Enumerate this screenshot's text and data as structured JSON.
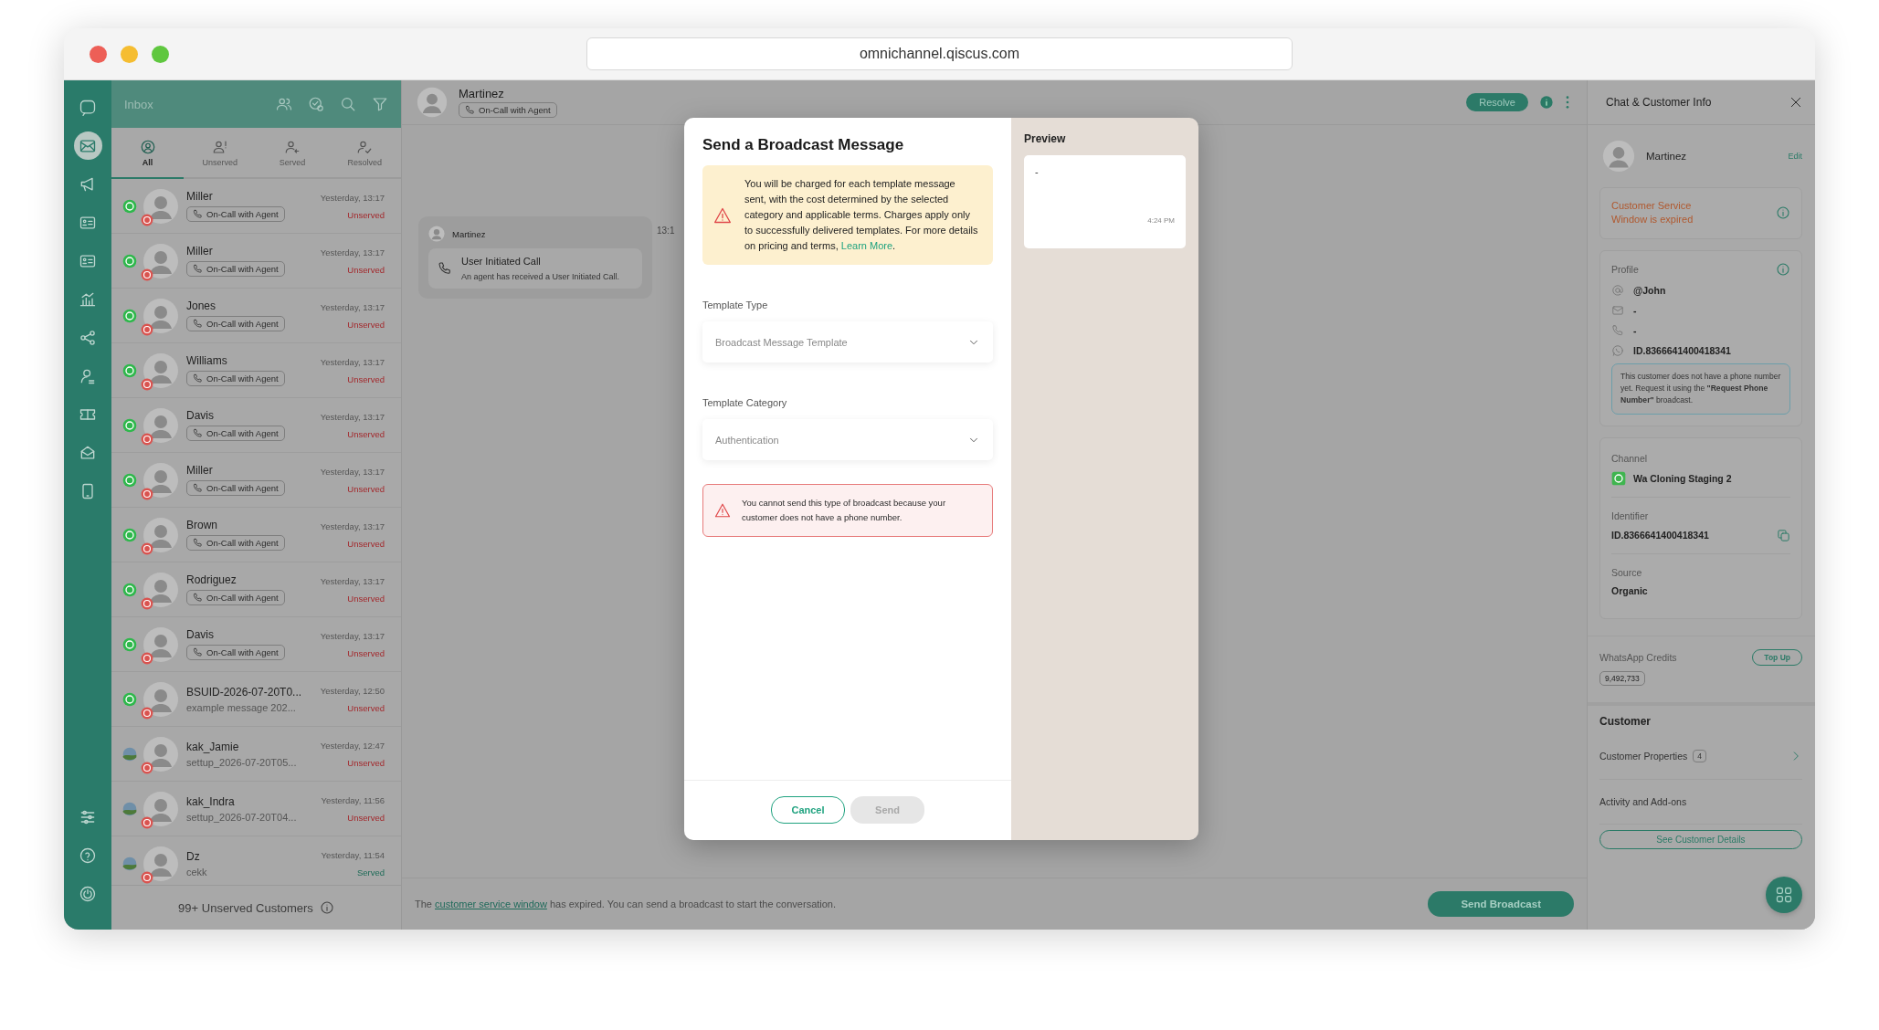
{
  "browser": {
    "url": "omnichannel.qiscus.com"
  },
  "nav": {
    "top": [
      {
        "kind": "chat",
        "selected": false
      },
      {
        "kind": "mail",
        "selected": true
      },
      {
        "kind": "megaphone",
        "selected": false
      },
      {
        "kind": "card",
        "selected": false
      },
      {
        "kind": "card",
        "selected": false
      },
      {
        "kind": "chart",
        "selected": false
      },
      {
        "kind": "share",
        "selected": false
      },
      {
        "kind": "person",
        "selected": false
      },
      {
        "kind": "ticket",
        "selected": false
      },
      {
        "kind": "tray",
        "selected": false
      },
      {
        "kind": "phone",
        "selected": false
      }
    ],
    "bottom": [
      {
        "kind": "sliders",
        "selected": false
      },
      {
        "kind": "help",
        "selected": false
      },
      {
        "kind": "power",
        "selected": false
      }
    ]
  },
  "inbox": {
    "title": "Inbox",
    "tabs": [
      {
        "label": "All",
        "kind": "all",
        "selected": true
      },
      {
        "label": "Unserved",
        "kind": "unserved",
        "selected": false
      },
      {
        "label": "Served",
        "kind": "served",
        "selected": false
      },
      {
        "label": "Resolved",
        "kind": "resolved",
        "selected": false
      }
    ],
    "conversations": [
      {
        "name": "Miller",
        "time": "Yesterday, 13:17",
        "kind": "call",
        "tag": "On-Call with Agent",
        "status": "Unserved",
        "served": false,
        "whatsapp": true
      },
      {
        "name": "Miller",
        "time": "Yesterday, 13:17",
        "kind": "call",
        "tag": "On-Call with Agent",
        "status": "Unserved",
        "served": false,
        "whatsapp": true
      },
      {
        "name": "Jones",
        "time": "Yesterday, 13:17",
        "kind": "call",
        "tag": "On-Call with Agent",
        "status": "Unserved",
        "served": false,
        "whatsapp": true
      },
      {
        "name": "Williams",
        "time": "Yesterday, 13:17",
        "kind": "call",
        "tag": "On-Call with Agent",
        "status": "Unserved",
        "served": false,
        "whatsapp": true
      },
      {
        "name": "Davis",
        "time": "Yesterday, 13:17",
        "kind": "call",
        "tag": "On-Call with Agent",
        "status": "Unserved",
        "served": false,
        "whatsapp": true
      },
      {
        "name": "Miller",
        "time": "Yesterday, 13:17",
        "kind": "call",
        "tag": "On-Call with Agent",
        "status": "Unserved",
        "served": false,
        "whatsapp": true
      },
      {
        "name": "Brown",
        "time": "Yesterday, 13:17",
        "kind": "call",
        "tag": "On-Call with Agent",
        "status": "Unserved",
        "served": false,
        "whatsapp": true
      },
      {
        "name": "Rodriguez",
        "time": "Yesterday, 13:17",
        "kind": "call",
        "tag": "On-Call with Agent",
        "status": "Unserved",
        "served": false,
        "whatsapp": true
      },
      {
        "name": "Davis",
        "time": "Yesterday, 13:17",
        "kind": "call",
        "tag": "On-Call with Agent",
        "status": "Unserved",
        "served": false,
        "whatsapp": true
      },
      {
        "name": "BSUID-2026-07-20T0...",
        "time": "Yesterday, 12:50",
        "kind": "message",
        "preview": "example message 202...",
        "status": "Unserved",
        "served": false,
        "whatsapp": true
      },
      {
        "name": "kak_Jamie",
        "time": "Yesterday, 12:47",
        "kind": "message",
        "preview": "settup_2026-07-20T05...",
        "status": "Unserved",
        "served": false,
        "whatsapp": false
      },
      {
        "name": "kak_Indra",
        "time": "Yesterday, 11:56",
        "kind": "message",
        "preview": "settup_2026-07-20T04...",
        "status": "Unserved",
        "served": false,
        "whatsapp": false
      },
      {
        "name": "Dz",
        "time": "Yesterday, 11:54",
        "kind": "message",
        "preview": "cekk",
        "status": "Served",
        "served": true,
        "whatsapp": false
      }
    ],
    "footer": "99+ Unserved Customers"
  },
  "chat": {
    "contact": {
      "name": "Martinez",
      "tag": "On-Call with Agent"
    },
    "resolve": "Resolve",
    "messages": [
      {
        "sender": "Martinez",
        "title": "User Initiated Call",
        "body": "An agent has received a User Initiated Call.",
        "time": "13:1"
      }
    ],
    "notice": {
      "before": "The ",
      "link": "customer service window",
      "after": " has expired. You can send a broadcast to start the conversation."
    },
    "broadcast_button": "Send Broadcast"
  },
  "modal": {
    "title": "Send a Broadcast Message",
    "warning": {
      "text": "You will be charged for each template message sent, with the cost determined by the selected category and applicable terms. Charges apply only to successfully delivered templates. For more details on pricing and terms, ",
      "link": "Learn More",
      "after": "."
    },
    "fields": [
      {
        "label": "Template Type",
        "value": "Broadcast Message Template"
      },
      {
        "label": "Template Category",
        "value": "Authentication"
      }
    ],
    "error": "You cannot send this type of broadcast because your customer does not have a phone number.",
    "buttons": [
      {
        "label": "Cancel",
        "kind": "secondary",
        "disabled": false
      },
      {
        "label": "Send",
        "kind": "primary",
        "disabled": true
      }
    ],
    "preview": {
      "title": "Preview",
      "text": "-",
      "time": "4:24 PM"
    }
  },
  "info": {
    "title": "Chat & Customer Info",
    "customer": {
      "name": "Martinez",
      "edit": "Edit"
    },
    "alert": "Customer Service Window is expired",
    "profile": {
      "label": "Profile",
      "rows": [
        {
          "kind": "handle",
          "value": "@John"
        },
        {
          "kind": "email",
          "value": "-"
        },
        {
          "kind": "phone",
          "value": "-"
        },
        {
          "kind": "whatsapp",
          "value": "ID.8366641400418341"
        }
      ],
      "note": "This customer does not have a phone number yet. Request it using the **\"Request Phone Number\"** broadcast."
    },
    "details": [
      {
        "label": "Channel",
        "value": "Wa Cloning Staging 2",
        "kind": "channel"
      },
      {
        "label": "Identifier",
        "value": "ID.8366641400418341",
        "kind": "copy"
      },
      {
        "label": "Source",
        "value": "Organic",
        "kind": "plain"
      }
    ],
    "credits": {
      "label": "WhatsApp Credits",
      "button": "Top Up",
      "value": "9,492,733"
    },
    "customer_section": {
      "title": "Customer",
      "items": [
        {
          "label": "Customer Properties",
          "count": "4"
        },
        {
          "label": "Activity and Add-ons"
        }
      ],
      "button": "See Customer Details"
    }
  }
}
